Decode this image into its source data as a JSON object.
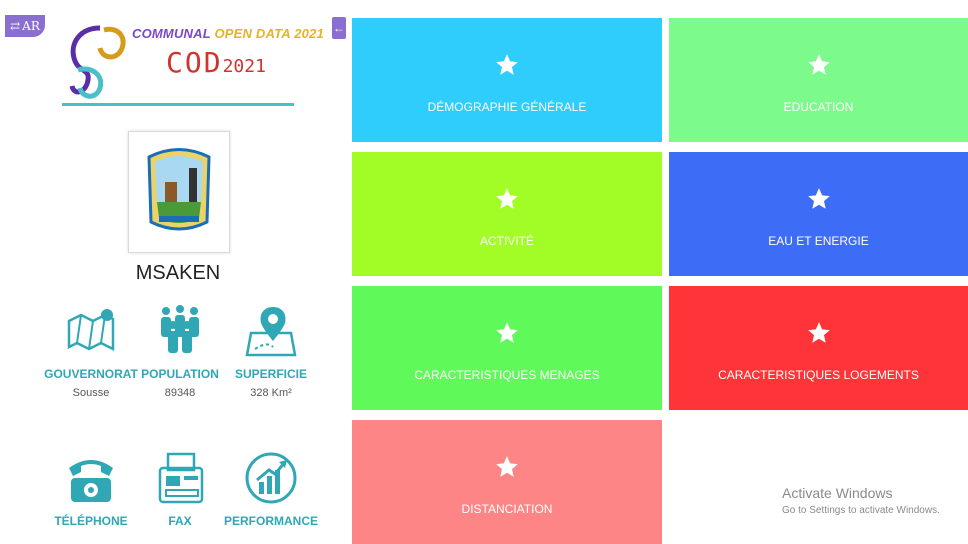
{
  "lang_button": "AR",
  "logo": {
    "title_part1": "COMMUNAL",
    "title_part2": "OPEN DATA 2021",
    "sub_big": "COD",
    "sub_small": "2021"
  },
  "city": "MSAKEN",
  "stats": [
    {
      "label": "GOUVERNORAT",
      "value": "Sousse",
      "icon": "map-icon"
    },
    {
      "label": "POPULATION",
      "value": "89348",
      "icon": "people-icon"
    },
    {
      "label": "SUPERFICIE",
      "value": "328 Km²",
      "icon": "location-pin-icon"
    },
    {
      "label": "TÉLÉPHONE",
      "value": "",
      "icon": "telephone-icon"
    },
    {
      "label": "FAX",
      "value": "",
      "icon": "fax-icon"
    },
    {
      "label": "PERFORMANCE",
      "value": "",
      "icon": "performance-icon"
    }
  ],
  "tiles": [
    {
      "label": "DÉMOGRAPHIE GÉNÉRALE",
      "color": "#2ecdfc"
    },
    {
      "label": "EDUCATION",
      "color": "#7dfa8c"
    },
    {
      "label": "ACTIVITÉ",
      "color": "#a1fd25"
    },
    {
      "label": "EAU ET ENERGIE",
      "color": "#3d6df7"
    },
    {
      "label": "CARACTERISTIQUES MENAGES",
      "color": "#5ffa5a"
    },
    {
      "label": "CARACTERISTIQUES LOGEMENTS",
      "color": "#fe3438"
    },
    {
      "label": "DISTANCIATION",
      "color": "#fd8585"
    }
  ],
  "watermark": {
    "line1": "Activate Windows",
    "line2": "Go to Settings to activate Windows."
  }
}
